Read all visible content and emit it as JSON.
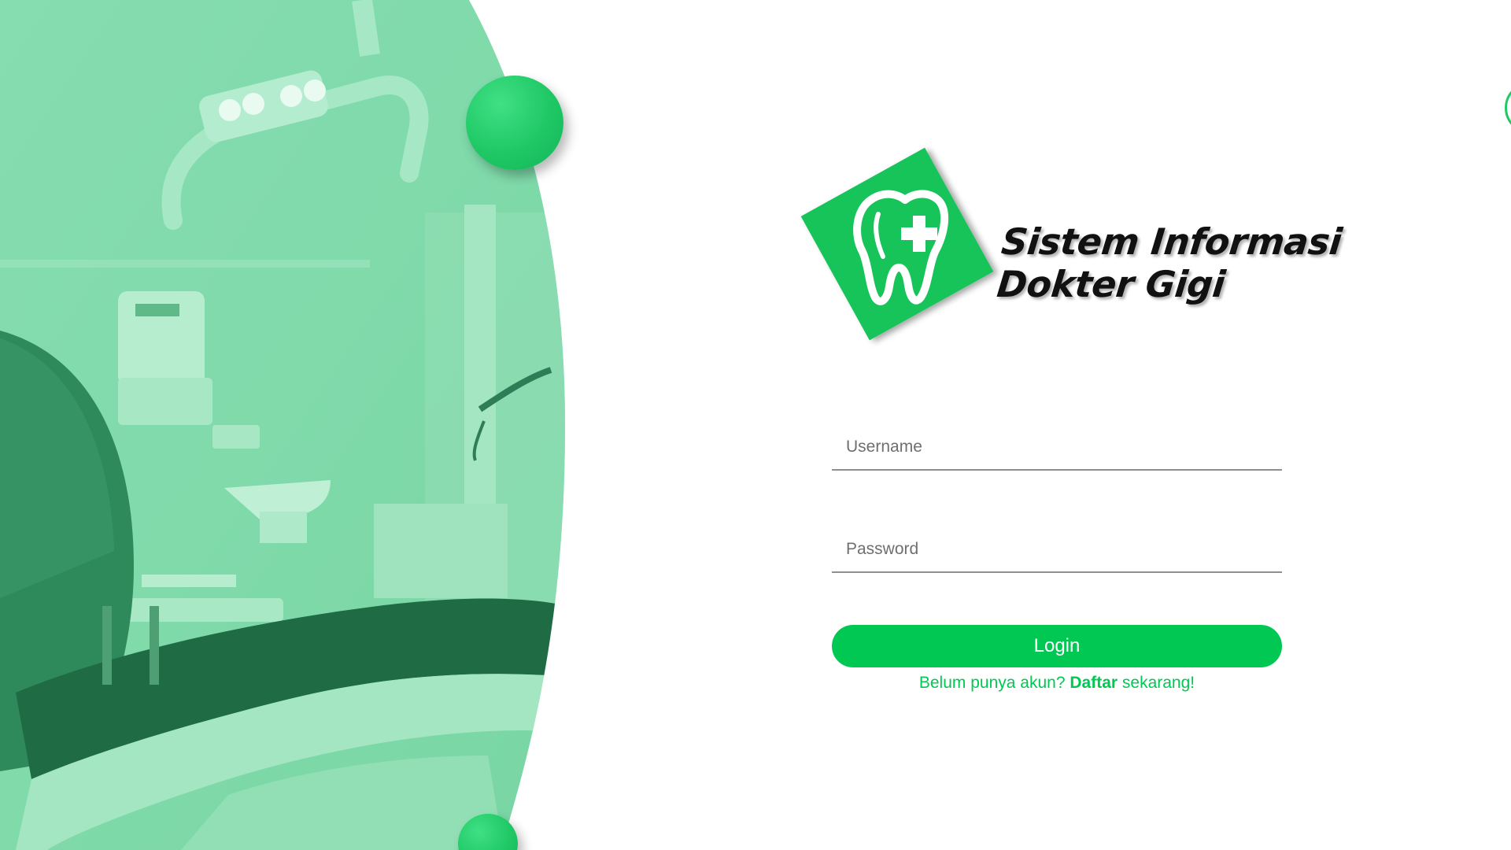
{
  "app": {
    "logo_line1": "Sistem Informasi",
    "logo_line2": "Dokter Gigi"
  },
  "form": {
    "username_placeholder": "Username",
    "username_value": "",
    "password_placeholder": "Password",
    "password_value": "",
    "login_label": "Login"
  },
  "register": {
    "prefix": "Belum punya akun?",
    "link_label": "Daftar",
    "suffix": "sekarang!"
  },
  "icons": {
    "logo": "tooth-plus-logo-icon",
    "hero": "dental-clinic-photo"
  },
  "colors": {
    "accent": "#00c853",
    "hero_overlay": "#7fdcaa",
    "text": "#111111"
  }
}
